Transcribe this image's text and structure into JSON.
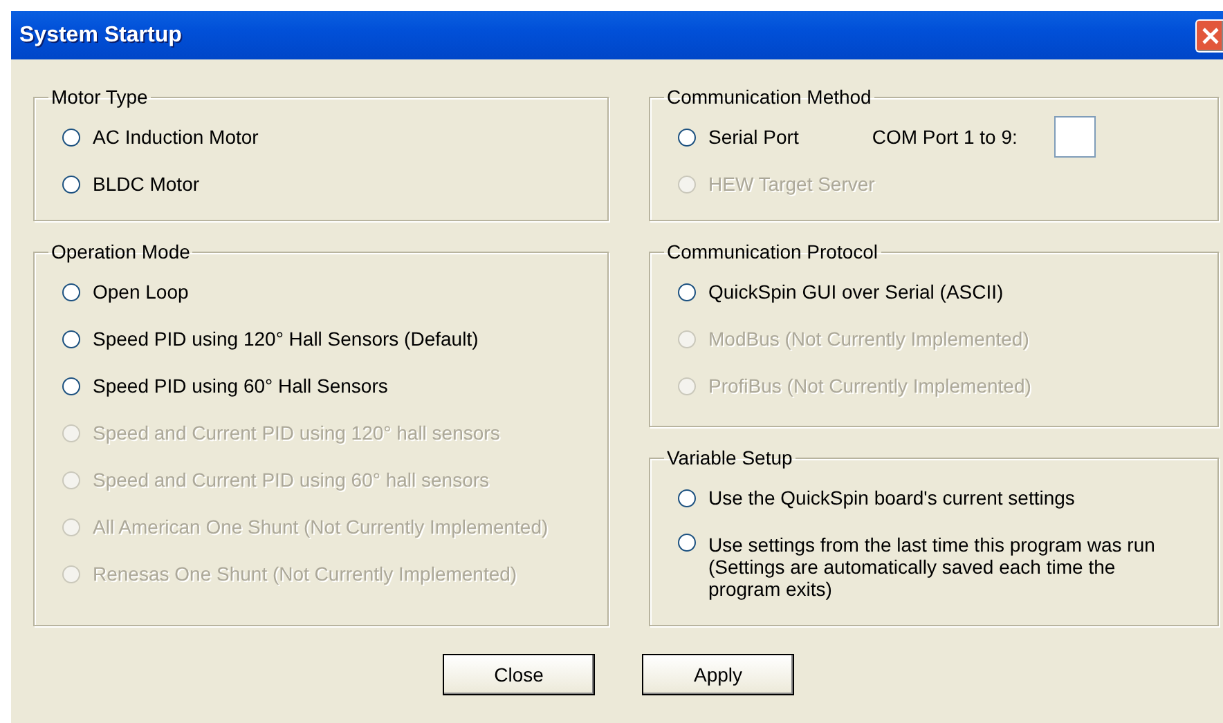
{
  "window": {
    "title": "System Startup"
  },
  "left_column": [
    {
      "title": "Motor Type",
      "items": [
        {
          "kind": "radio",
          "label": "AC Induction Motor",
          "selected": false,
          "disabled": false
        },
        {
          "kind": "radio",
          "label": "BLDC Motor",
          "selected": false,
          "disabled": false
        }
      ]
    },
    {
      "title": "Operation Mode",
      "items": [
        {
          "kind": "radio",
          "label": "Open Loop",
          "selected": false,
          "disabled": false
        },
        {
          "kind": "radio",
          "label": "Speed PID using 120° Hall Sensors (Default)",
          "selected": false,
          "disabled": false
        },
        {
          "kind": "radio",
          "label": "Speed PID using 60° Hall Sensors",
          "selected": false,
          "disabled": false
        },
        {
          "kind": "radio",
          "label": "Speed and Current PID using 120° hall sensors",
          "selected": false,
          "disabled": true
        },
        {
          "kind": "radio",
          "label": "Speed and Current PID using 60° hall sensors",
          "selected": false,
          "disabled": true
        },
        {
          "kind": "radio",
          "label": "All American One Shunt (Not Currently Implemented)",
          "selected": false,
          "disabled": true
        },
        {
          "kind": "radio",
          "label": "Renesas One Shunt (Not Currently Implemented)",
          "selected": false,
          "disabled": true
        }
      ]
    }
  ],
  "right_column": [
    {
      "title": "Communication Method",
      "items": [
        {
          "kind": "radio_with_field",
          "label": "Serial Port",
          "selected": false,
          "disabled": false,
          "field_label": "COM Port 1 to 9:"
        },
        {
          "kind": "radio",
          "label": "HEW Target Server",
          "selected": false,
          "disabled": true
        }
      ]
    },
    {
      "title": "Communication Protocol",
      "items": [
        {
          "kind": "radio",
          "label": "QuickSpin GUI over Serial (ASCII)",
          "selected": false,
          "disabled": false
        },
        {
          "kind": "radio",
          "label": "ModBus (Not Currently Implemented)",
          "selected": false,
          "disabled": true
        },
        {
          "kind": "radio",
          "label": "ProfiBus (Not Currently Implemented)",
          "selected": false,
          "disabled": true
        }
      ]
    },
    {
      "title": "Variable Setup",
      "items": [
        {
          "kind": "radio",
          "label": "Use the QuickSpin board's current settings",
          "selected": false,
          "disabled": false
        },
        {
          "kind": "radio",
          "label": "Use settings from the last time this program was run (Settings are automatically saved each time the program exits)",
          "selected": false,
          "disabled": false
        }
      ]
    }
  ],
  "buttons": [
    "Close",
    "Apply"
  ]
}
